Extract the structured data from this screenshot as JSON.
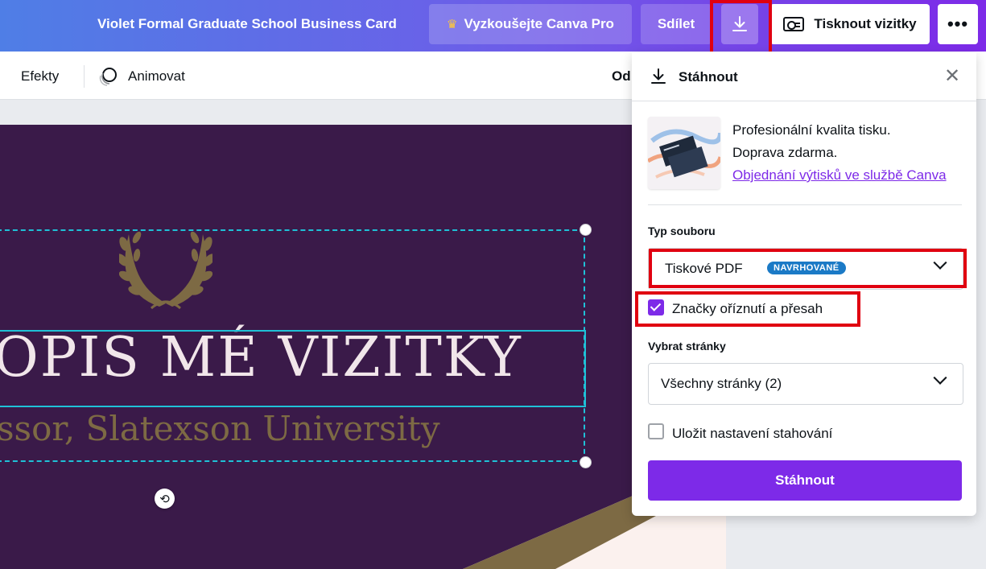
{
  "topbar": {
    "doc_title": "Violet Formal Graduate School Business Card",
    "pro_label": "Vyzkoušejte Canva Pro",
    "pro_icon": "crown-icon",
    "share_label": "Sdílet",
    "download_icon": "download-icon",
    "print_label": "Tisknout vizitky",
    "print_icon": "business-card-icon",
    "more_label": "•••"
  },
  "toolbar": {
    "effects_label": "Efekty",
    "animate_label": "Animovat",
    "animate_icon": "animate-icon",
    "partial_label": "Od"
  },
  "canvas": {
    "title_text": "OPIS MÉ VIZITKY",
    "subtitle_text": "ssor, Slatexson University",
    "rotate_icon": "rotate-icon",
    "laurel_icon": "laurel-wreath-icon",
    "colors": {
      "background": "#3a1a49",
      "title": "#f1e6ea",
      "subtitle": "#7d6a44",
      "selection": "#1fc1d7"
    }
  },
  "download_panel": {
    "title": "Stáhnout",
    "close_icon": "close-icon",
    "promo": {
      "line1": "Profesionální kvalita tisku.",
      "line2": "Doprava zdarma.",
      "link": "Objednání výtisků ve službě Canva"
    },
    "file_type": {
      "label": "Typ souboru",
      "value": "Tiskové PDF",
      "badge": "NAVRHOVANÉ"
    },
    "crop_marks": {
      "label": "Značky oříznutí a přesah",
      "checked": true
    },
    "pages": {
      "label": "Vybrat stránky",
      "value": "Všechny stránky (2)"
    },
    "save_settings": {
      "label": "Uložit nastavení stahování",
      "checked": false
    },
    "download_button": "Stáhnout",
    "accent_color": "#7d2ae8"
  }
}
